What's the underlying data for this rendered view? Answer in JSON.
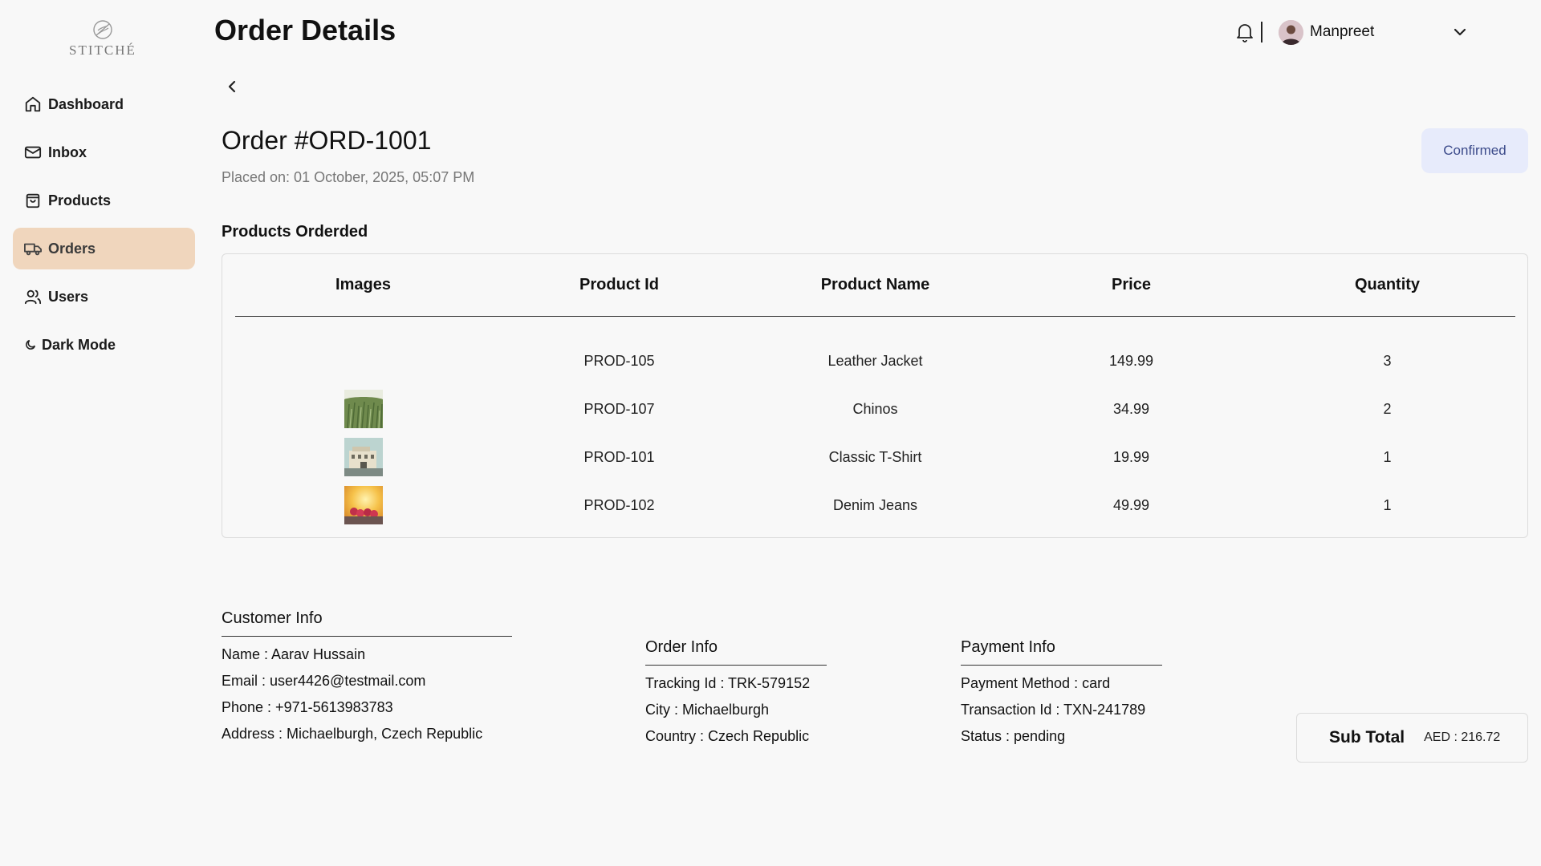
{
  "brand": {
    "name": "STITCHÉ"
  },
  "nav": {
    "items": [
      {
        "label": "Dashboard",
        "icon": "home-icon"
      },
      {
        "label": "Inbox",
        "icon": "mail-icon"
      },
      {
        "label": "Products",
        "icon": "shopping-bag-icon"
      },
      {
        "label": "Orders",
        "icon": "truck-icon",
        "active": true
      },
      {
        "label": "Users",
        "icon": "users-icon"
      },
      {
        "label": "Dark Mode",
        "icon": "moon-icon"
      }
    ]
  },
  "header": {
    "title": "Order Details",
    "user_name": "Manpreet"
  },
  "order": {
    "title": "Order #ORD-1001",
    "placed_on": "Placed on: 01 October, 2025, 05:07 PM",
    "status": "Confirmed"
  },
  "products": {
    "section_title": "Products Orderded",
    "columns": [
      "Images",
      "Product Id",
      "Product Name",
      "Price",
      "Quantity"
    ],
    "rows": [
      {
        "image": "",
        "id": "PROD-105",
        "name": "Leather Jacket",
        "price": "149.99",
        "qty": "3"
      },
      {
        "image": "grass-photo",
        "id": "PROD-107",
        "name": "Chinos",
        "price": "34.99",
        "qty": "2"
      },
      {
        "image": "building-photo",
        "id": "PROD-101",
        "name": "Classic T-Shirt",
        "price": "19.99",
        "qty": "1"
      },
      {
        "image": "berries-photo",
        "id": "PROD-102",
        "name": "Denim Jeans",
        "price": "49.99",
        "qty": "1"
      }
    ]
  },
  "customer": {
    "title": "Customer Info",
    "lines": [
      "Name : Aarav Hussain",
      "Email : user4426@testmail.com",
      "Phone : +971-5613983783",
      "Address : Michaelburgh, Czech Republic"
    ]
  },
  "order_info": {
    "title": "Order Info",
    "lines": [
      "Tracking Id : TRK-579152",
      "City : Michaelburgh",
      "Country : Czech Republic"
    ]
  },
  "payment": {
    "title": "Payment Info",
    "lines": [
      "Payment Method : card",
      "Transaction Id : TXN-241789",
      "Status : pending"
    ]
  },
  "subtotal": {
    "label": "Sub Total",
    "value": "AED : 216.72"
  },
  "colors": {
    "active_nav": "#f0d6bd",
    "badge_bg": "#e7ebfb",
    "badge_text": "#3b4a8a"
  }
}
